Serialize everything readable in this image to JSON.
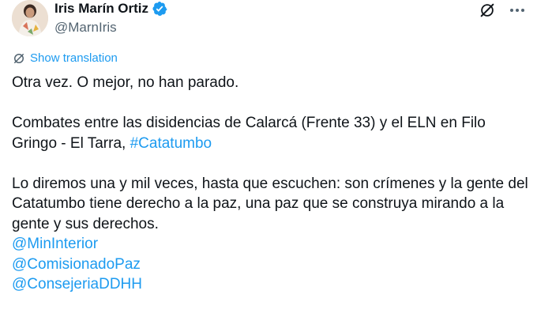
{
  "author": {
    "display_name": "Iris Marín Ortiz",
    "handle": "@MarnIris",
    "verified": true,
    "avatar_icon": "profile-photo"
  },
  "actions": {
    "grok_icon": "grok-slash-icon",
    "more_icon": "ellipsis-icon"
  },
  "translate": {
    "label": "Show translation",
    "icon": "translate-icon"
  },
  "tweet": {
    "line1": "Otra vez. O mejor, no han parado.",
    "para2_text": "Combates entre las disidencias de Calarcá (Frente 33) y el ELN en Filo Gringo - El Tarra, ",
    "hashtag": "#Catatumbo",
    "para3_text": "Lo diremos una y mil veces, hasta que escuchen: son crímenes y la gente del Catatumbo tiene derecho a la paz, una paz que se construya mirando a la gente y sus derechos.",
    "mentions": [
      "@MinInterior",
      "@ComisionadoPaz",
      "@ConsejeriaDDHH"
    ]
  },
  "colors": {
    "link": "#1d9bf0",
    "text": "#0f1419",
    "secondary": "#536471",
    "verified": "#1d9bf0"
  }
}
